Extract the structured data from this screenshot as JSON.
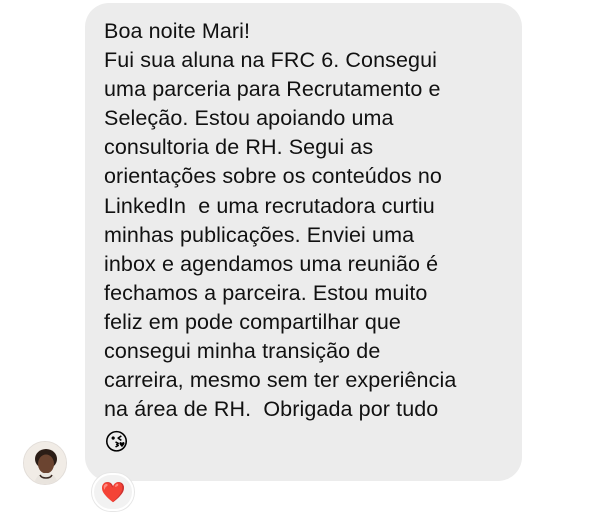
{
  "message": {
    "lines": [
      "Boa noite Mari!",
      "Fui sua aluna na FRC 6. Consegui",
      "uma parceria para Recrutamento e",
      "Seleção. Estou apoiando uma",
      "consultoria de RH. Segui as",
      "orientações sobre os conteúdos no",
      "LinkedIn  e uma recrutadora curtiu",
      "minhas publicações. Enviei uma",
      "inbox e agendamos uma reunião é",
      "fechamos a parceira. Estou muito",
      "feliz em pode compartilhar que",
      "consegui minha transição de",
      "carreira, mesmo sem ter experiência",
      "na área de RH.  Obrigada por tudo"
    ],
    "emoji": "😘",
    "emoji_name": "face-blowing-kiss-icon"
  },
  "reaction": {
    "emoji": "❤️",
    "icon_name": "heart-icon",
    "color": "#e0245e"
  },
  "colors": {
    "bubble": "#ececec",
    "text": "#111111",
    "background": "#ffffff"
  },
  "sender": {
    "avatar_icon": "avatar-icon"
  }
}
